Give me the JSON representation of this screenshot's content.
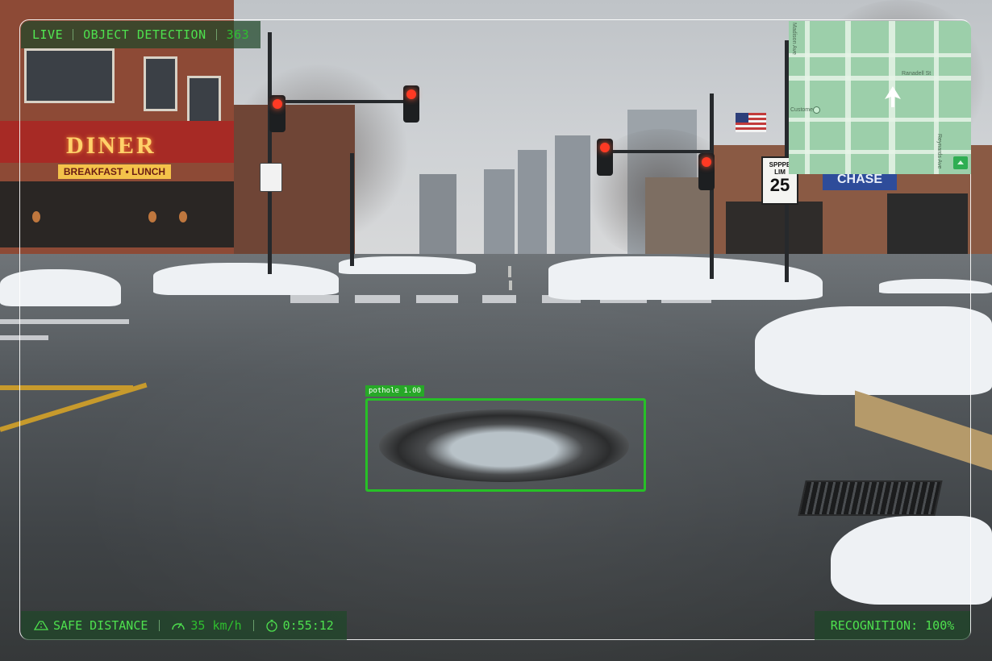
{
  "hud": {
    "top": {
      "live": "LIVE",
      "mode": "OBJECT DETECTION",
      "count": "363"
    },
    "bottom": {
      "distance_icon": "road-icon",
      "distance_label": "SAFE DISTANCE",
      "speed_icon": "speedometer-icon",
      "speed": "35 km/h",
      "timer_icon": "stopwatch-icon",
      "elapsed": "0:55:12"
    },
    "recognition": "RECOGNITION: 100%"
  },
  "detection": {
    "label": "pothole 1.00",
    "color": "#27c027"
  },
  "map": {
    "streets": {
      "madison": "Madison Ave",
      "ranadell": "Ranadell St",
      "reynards": "Reynards Ave",
      "poi": "Custome"
    },
    "icon": "navigation-arrow-icon"
  },
  "scene": {
    "diner_sign": "DINER",
    "diner_subsign": "BREAKFAST • LUNCH",
    "bank_sign": "CHASE",
    "speed_sign_top": "SPPPE LIM",
    "speed_sign_value": "25"
  },
  "colors": {
    "hud_green": "#4ee04e",
    "hud_panel": "rgba(30,70,40,0.72)",
    "box_green": "#27c027"
  }
}
